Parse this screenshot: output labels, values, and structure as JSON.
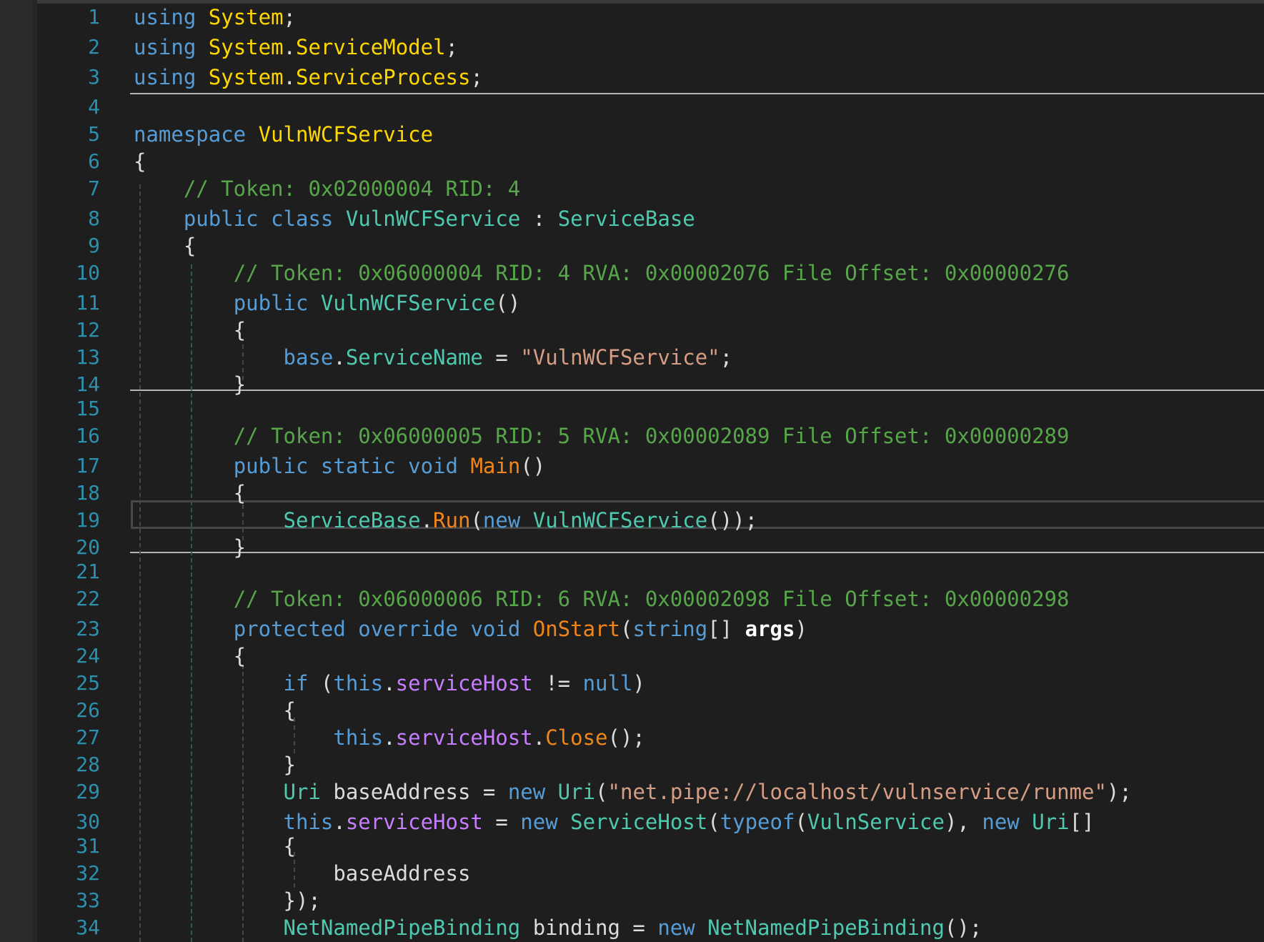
{
  "editor": {
    "lines": [
      {
        "n": "1",
        "tokens": [
          [
            "kw",
            "using"
          ],
          [
            "p",
            " "
          ],
          [
            "ns",
            "System"
          ],
          [
            "p",
            ";"
          ]
        ]
      },
      {
        "n": "2",
        "tokens": [
          [
            "kw",
            "using"
          ],
          [
            "p",
            " "
          ],
          [
            "ns",
            "System"
          ],
          [
            "p",
            "."
          ],
          [
            "ns",
            "ServiceModel"
          ],
          [
            "p",
            ";"
          ]
        ]
      },
      {
        "n": "3",
        "tokens": [
          [
            "kw",
            "using"
          ],
          [
            "p",
            " "
          ],
          [
            "ns",
            "System"
          ],
          [
            "p",
            "."
          ],
          [
            "ns",
            "ServiceProcess"
          ],
          [
            "p",
            ";"
          ]
        ]
      },
      {
        "n": "4",
        "tokens": []
      },
      {
        "n": "5",
        "tokens": [
          [
            "kw",
            "namespace"
          ],
          [
            "p",
            " "
          ],
          [
            "ns",
            "VulnWCFService"
          ]
        ]
      },
      {
        "n": "6",
        "tokens": [
          [
            "p",
            "{"
          ]
        ]
      },
      {
        "n": "7",
        "tokens": [
          [
            "p",
            "    "
          ],
          [
            "c",
            "// Token: 0x02000004 RID: 4"
          ]
        ]
      },
      {
        "n": "8",
        "tokens": [
          [
            "p",
            "    "
          ],
          [
            "kw",
            "public"
          ],
          [
            "p",
            " "
          ],
          [
            "kw",
            "class"
          ],
          [
            "p",
            " "
          ],
          [
            "ty",
            "VulnWCFService"
          ],
          [
            "p",
            " : "
          ],
          [
            "ty",
            "ServiceBase"
          ]
        ]
      },
      {
        "n": "9",
        "tokens": [
          [
            "p",
            "    {"
          ]
        ]
      },
      {
        "n": "10",
        "tokens": [
          [
            "p",
            "        "
          ],
          [
            "c",
            "// Token: 0x06000004 RID: 4 RVA: 0x00002076 File Offset: 0x00000276"
          ]
        ]
      },
      {
        "n": "11",
        "tokens": [
          [
            "p",
            "        "
          ],
          [
            "kw",
            "public"
          ],
          [
            "p",
            " "
          ],
          [
            "ty",
            "VulnWCFService"
          ],
          [
            "p",
            "()"
          ]
        ]
      },
      {
        "n": "12",
        "tokens": [
          [
            "p",
            "        {"
          ]
        ]
      },
      {
        "n": "13",
        "tokens": [
          [
            "p",
            "            "
          ],
          [
            "kw",
            "base"
          ],
          [
            "p",
            "."
          ],
          [
            "pr",
            "ServiceName"
          ],
          [
            "p",
            " = "
          ],
          [
            "s",
            "\"VulnWCFService\""
          ],
          [
            "p",
            ";"
          ]
        ]
      },
      {
        "n": "14",
        "tokens": [
          [
            "p",
            "        }"
          ]
        ]
      },
      {
        "n": "15",
        "tokens": []
      },
      {
        "n": "16",
        "tokens": [
          [
            "p",
            "        "
          ],
          [
            "c",
            "// Token: 0x06000005 RID: 5 RVA: 0x00002089 File Offset: 0x00000289"
          ]
        ]
      },
      {
        "n": "17",
        "tokens": [
          [
            "p",
            "        "
          ],
          [
            "kw",
            "public"
          ],
          [
            "p",
            " "
          ],
          [
            "kw",
            "static"
          ],
          [
            "p",
            " "
          ],
          [
            "kw",
            "void"
          ],
          [
            "p",
            " "
          ],
          [
            "m",
            "Main"
          ],
          [
            "p",
            "()"
          ]
        ]
      },
      {
        "n": "18",
        "tokens": [
          [
            "p",
            "        {"
          ]
        ]
      },
      {
        "n": "19",
        "tokens": [
          [
            "p",
            "            "
          ],
          [
            "ty",
            "ServiceBase"
          ],
          [
            "p",
            "."
          ],
          [
            "m",
            "Run"
          ],
          [
            "p",
            "("
          ],
          [
            "kw",
            "new"
          ],
          [
            "p",
            " "
          ],
          [
            "ty",
            "VulnWCFService"
          ],
          [
            "p",
            "());"
          ]
        ]
      },
      {
        "n": "20",
        "tokens": [
          [
            "p",
            "        }"
          ]
        ]
      },
      {
        "n": "21",
        "tokens": []
      },
      {
        "n": "22",
        "tokens": [
          [
            "p",
            "        "
          ],
          [
            "c",
            "// Token: 0x06000006 RID: 6 RVA: 0x00002098 File Offset: 0x00000298"
          ]
        ]
      },
      {
        "n": "23",
        "tokens": [
          [
            "p",
            "        "
          ],
          [
            "kw",
            "protected"
          ],
          [
            "p",
            " "
          ],
          [
            "kw",
            "override"
          ],
          [
            "p",
            " "
          ],
          [
            "kw",
            "void"
          ],
          [
            "p",
            " "
          ],
          [
            "m",
            "OnStart"
          ],
          [
            "p",
            "("
          ],
          [
            "kw",
            "string"
          ],
          [
            "p",
            "[] "
          ],
          [
            "pa",
            "args"
          ],
          [
            "p",
            ")"
          ]
        ]
      },
      {
        "n": "24",
        "tokens": [
          [
            "p",
            "        {"
          ]
        ]
      },
      {
        "n": "25",
        "tokens": [
          [
            "p",
            "            "
          ],
          [
            "kw",
            "if"
          ],
          [
            "p",
            " ("
          ],
          [
            "kw",
            "this"
          ],
          [
            "p",
            "."
          ],
          [
            "f",
            "serviceHost"
          ],
          [
            "p",
            " != "
          ],
          [
            "kw",
            "null"
          ],
          [
            "p",
            ")"
          ]
        ]
      },
      {
        "n": "26",
        "tokens": [
          [
            "p",
            "            {"
          ]
        ]
      },
      {
        "n": "27",
        "tokens": [
          [
            "p",
            "                "
          ],
          [
            "kw",
            "this"
          ],
          [
            "p",
            "."
          ],
          [
            "f",
            "serviceHost"
          ],
          [
            "p",
            "."
          ],
          [
            "m",
            "Close"
          ],
          [
            "p",
            "();"
          ]
        ]
      },
      {
        "n": "28",
        "tokens": [
          [
            "p",
            "            }"
          ]
        ]
      },
      {
        "n": "29",
        "tokens": [
          [
            "p",
            "            "
          ],
          [
            "ty",
            "Uri"
          ],
          [
            "p",
            " baseAddress = "
          ],
          [
            "kw",
            "new"
          ],
          [
            "p",
            " "
          ],
          [
            "ty",
            "Uri"
          ],
          [
            "p",
            "("
          ],
          [
            "s",
            "\"net.pipe://localhost/vulnservice/runme\""
          ],
          [
            "p",
            ");"
          ]
        ]
      },
      {
        "n": "30",
        "tokens": [
          [
            "p",
            "            "
          ],
          [
            "kw",
            "this"
          ],
          [
            "p",
            "."
          ],
          [
            "f",
            "serviceHost"
          ],
          [
            "p",
            " = "
          ],
          [
            "kw",
            "new"
          ],
          [
            "p",
            " "
          ],
          [
            "ty",
            "ServiceHost"
          ],
          [
            "p",
            "("
          ],
          [
            "kw",
            "typeof"
          ],
          [
            "p",
            "("
          ],
          [
            "ty",
            "VulnService"
          ],
          [
            "p",
            "), "
          ],
          [
            "kw",
            "new"
          ],
          [
            "p",
            " "
          ],
          [
            "ty",
            "Uri"
          ],
          [
            "p",
            "[]"
          ]
        ]
      },
      {
        "n": "31",
        "tokens": [
          [
            "p",
            "            {"
          ]
        ]
      },
      {
        "n": "32",
        "tokens": [
          [
            "p",
            "                baseAddress"
          ]
        ]
      },
      {
        "n": "33",
        "tokens": [
          [
            "p",
            "            });"
          ]
        ]
      },
      {
        "n": "34",
        "tokens": [
          [
            "p",
            "            "
          ],
          [
            "ty",
            "NetNamedPipeBinding"
          ],
          [
            "p",
            " binding = "
          ],
          [
            "kw",
            "new"
          ],
          [
            "p",
            " "
          ],
          [
            "ty",
            "NetNamedPipeBinding"
          ],
          [
            "p",
            "();"
          ]
        ]
      }
    ]
  }
}
